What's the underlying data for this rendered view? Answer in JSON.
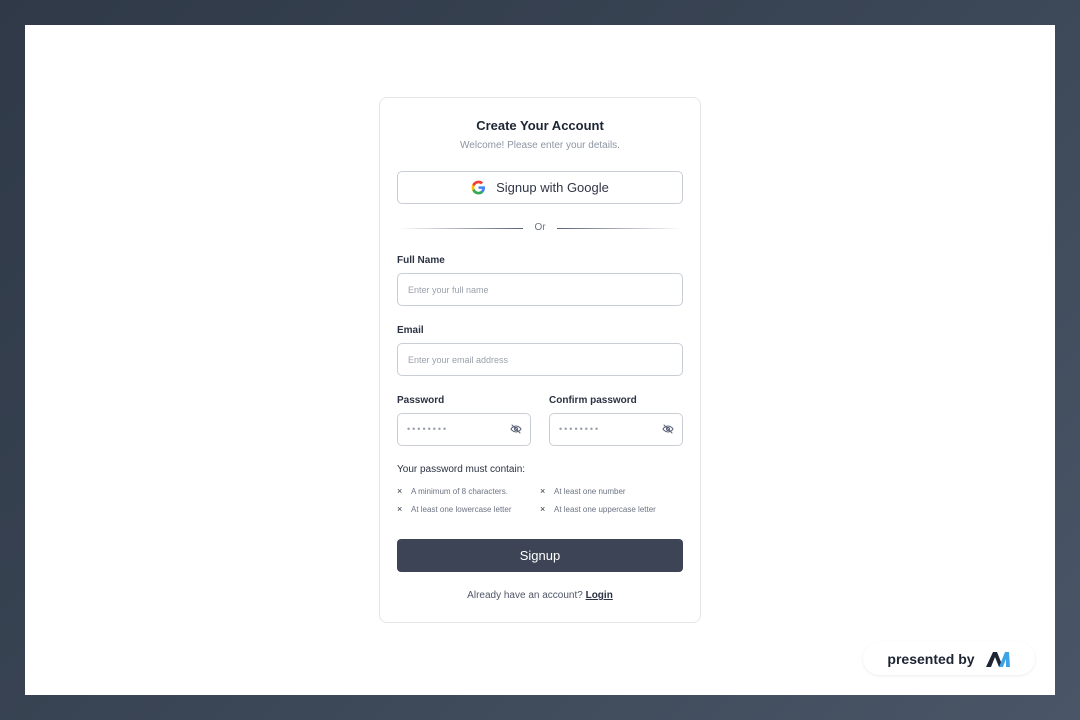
{
  "card": {
    "title": "Create Your Account",
    "subtitle": "Welcome! Please enter your details.",
    "google_button": "Signup with Google",
    "divider_text": "Or"
  },
  "fields": {
    "full_name": {
      "label": "Full Name",
      "placeholder": "Enter your full name"
    },
    "email": {
      "label": "Email",
      "placeholder": "Enter your email address"
    },
    "password": {
      "label": "Password",
      "masked": "••••••••"
    },
    "confirm_password": {
      "label": "Confirm password",
      "masked": "••••••••"
    }
  },
  "requirements": {
    "title": "Your password must contain:",
    "items": [
      "A minimum of 8 characters.",
      "At least one number",
      "At least one lowercase letter",
      "At least one uppercase letter"
    ],
    "status_mark": "×"
  },
  "signup_button": "Signup",
  "login_prompt": {
    "text": "Already have an account? ",
    "link": "Login"
  },
  "badge": {
    "text": "presented by"
  },
  "colors": {
    "primary_button": "#3c4456",
    "background": "#2f3947",
    "badge_logo_dark": "#1d2433",
    "badge_logo_accent": "#3fa3e8"
  },
  "icons": [
    "google-icon",
    "eye-off-icon",
    "close-x-icon",
    "brand-logo-icon"
  ]
}
